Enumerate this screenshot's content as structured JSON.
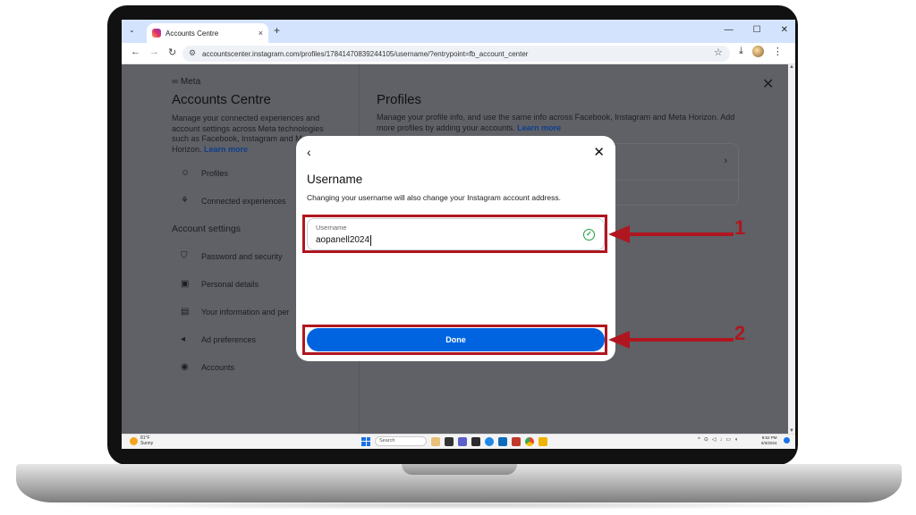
{
  "browser": {
    "tab_title": "Accounts Centre",
    "url": "accountscenter.instagram.com/profiles/17841470839244105/username/?entrypoint=fb_account_center",
    "new_tab_symbol": "+",
    "tab_close_symbol": "×"
  },
  "sidebar": {
    "brand": "∞ Meta",
    "title": "Accounts Centre",
    "description": "Manage your connected experiences and account settings across Meta technologies such as Facebook, Instagram and Meta Horizon.",
    "learn_more": "Learn more",
    "items": [
      {
        "label": "Profiles",
        "icon": "person-icon"
      },
      {
        "label": "Connected experiences",
        "icon": "connected-icon"
      }
    ],
    "section_title": "Account settings",
    "settings": [
      {
        "label": "Password and security",
        "icon": "shield-icon"
      },
      {
        "label": "Personal details",
        "icon": "id-card-icon"
      },
      {
        "label": "Your information and per",
        "icon": "info-icon"
      },
      {
        "label": "Ad preferences",
        "icon": "megaphone-icon"
      },
      {
        "label": "Accounts",
        "icon": "account-circle-icon"
      }
    ]
  },
  "main": {
    "title": "Profiles",
    "description": "Manage your profile info, and use the same info across Facebook, Instagram and Meta Horizon. Add more profiles by adding your accounts.",
    "learn_more": "Learn more"
  },
  "dialog": {
    "title": "Username",
    "subtitle": "Changing your username will also change your Instagram account address.",
    "field_label": "Username",
    "field_value": "aopanell2024",
    "done_label": "Done"
  },
  "taskbar": {
    "weather_temp": "81°F",
    "weather_desc": "Sunny",
    "search_placeholder": "Search",
    "time": "8:52 PM",
    "date": "6/3/2024"
  },
  "annotations": {
    "label_1": "1",
    "label_2": "2",
    "color": "#b0161f"
  }
}
